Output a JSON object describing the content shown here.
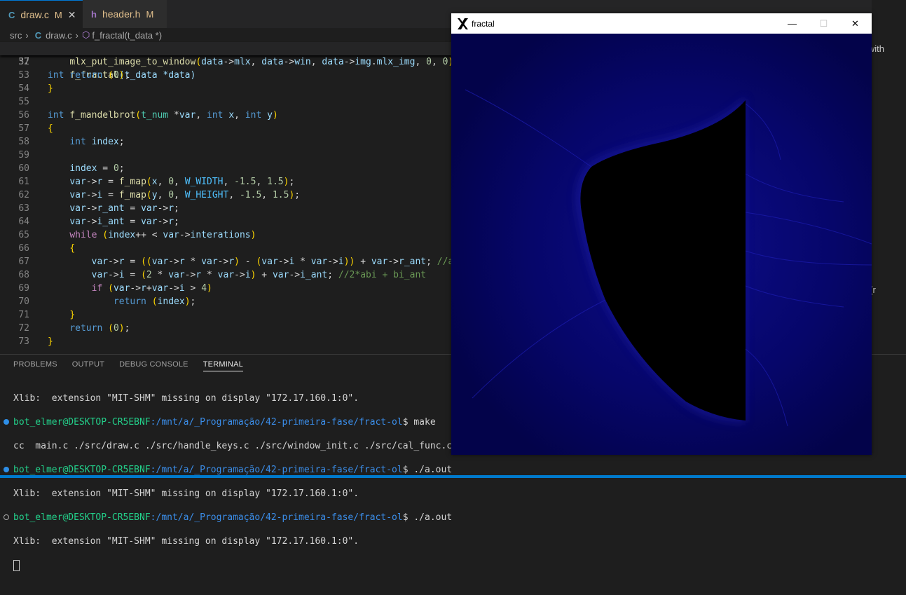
{
  "tabs": [
    {
      "lang": "C",
      "name": "draw.c",
      "mod": "M",
      "close": "✕"
    },
    {
      "lang": "h",
      "name": "header.h",
      "mod": "M"
    }
  ],
  "breadcrumb": {
    "folder": "src",
    "file": "draw.c",
    "symbol": "f_fractal(t_data *)"
  },
  "editor": {
    "sticky": {
      "ln": "37",
      "kw": "int",
      "fn": "f_fractal",
      "rest": "(t_data *data)"
    },
    "lines": [
      {
        "ln": "52",
        "text": "    mlx_put_image_to_window(data->mlx, data->win, data->img.mlx_img, 0, 0);"
      },
      {
        "ln": "53",
        "text": "    return (0);"
      },
      {
        "ln": "54",
        "text": "}"
      },
      {
        "ln": "55",
        "text": ""
      },
      {
        "ln": "56",
        "text": "int f_mandelbrot(t_num *var, int x, int y)"
      },
      {
        "ln": "57",
        "text": "{"
      },
      {
        "ln": "58",
        "text": "    int index;"
      },
      {
        "ln": "59",
        "text": ""
      },
      {
        "ln": "60",
        "text": "    index = 0;"
      },
      {
        "ln": "61",
        "text": "    var->r = f_map(x, 0, W_WIDTH, -1.5, 1.5);"
      },
      {
        "ln": "62",
        "text": "    var->i = f_map(y, 0, W_HEIGHT, -1.5, 1.5);"
      },
      {
        "ln": "63",
        "text": "    var->r_ant = var->r;"
      },
      {
        "ln": "64",
        "text": "    var->i_ant = var->r;"
      },
      {
        "ln": "65",
        "text": "    while (index++ < var->interations)"
      },
      {
        "ln": "66",
        "text": "    {"
      },
      {
        "ln": "67",
        "text": "        var->r = ((var->r * var->r) - (var->i * var->i)) + var->r_ant; //a²"
      },
      {
        "ln": "68",
        "text": "        var->i = (2 * var->r * var->i) + var->i_ant; //2*abi + bi_ant"
      },
      {
        "ln": "69",
        "text": "        if (var->r+var->i > 4)"
      },
      {
        "ln": "70",
        "text": "            return (index);"
      },
      {
        "ln": "71",
        "text": "    }"
      },
      {
        "ln": "72",
        "text": "    return (0);"
      },
      {
        "ln": "73",
        "text": "}"
      }
    ]
  },
  "panel": {
    "tabs": [
      "PROBLEMS",
      "OUTPUT",
      "DEBUG CONSOLE",
      "TERMINAL"
    ],
    "active_tab": "TERMINAL"
  },
  "terminal": {
    "line1": "Xlib:  extension \"MIT-SHM\" missing on display \"172.17.160.1:0\".",
    "prompt_user": "bot_elmer@DESKTOP-CR5EBNF",
    "prompt_path": ":/mnt/a/_Programação/42-primeira-fase/fract-ol",
    "cmd_make": "$ make",
    "cc_line": "cc  main.c ./src/draw.c ./src/handle_keys.c ./src/window_init.c ./src/cal_func.c  -lm -Im",
    "cmd_run": "$ ./a.out",
    "xlib2": "Xlib:  extension \"MIT-SHM\" missing on display \"172.17.160.1:0\".",
    "xlib3": "Xlib:  extension \"MIT-SHM\" missing on display \"172.17.160.1:0\"."
  },
  "fractal_window": {
    "title": "fractal",
    "min": "—",
    "max": "☐",
    "close": "✕"
  },
  "side": {
    "t1": "n with",
    "t2": "p(r",
    "t3": "sh",
    "t4": "sh",
    "t5": "out"
  },
  "colors": {
    "fractal_bg": "#00004a",
    "fractal_shape": "#000000",
    "accent": "#007acc"
  }
}
